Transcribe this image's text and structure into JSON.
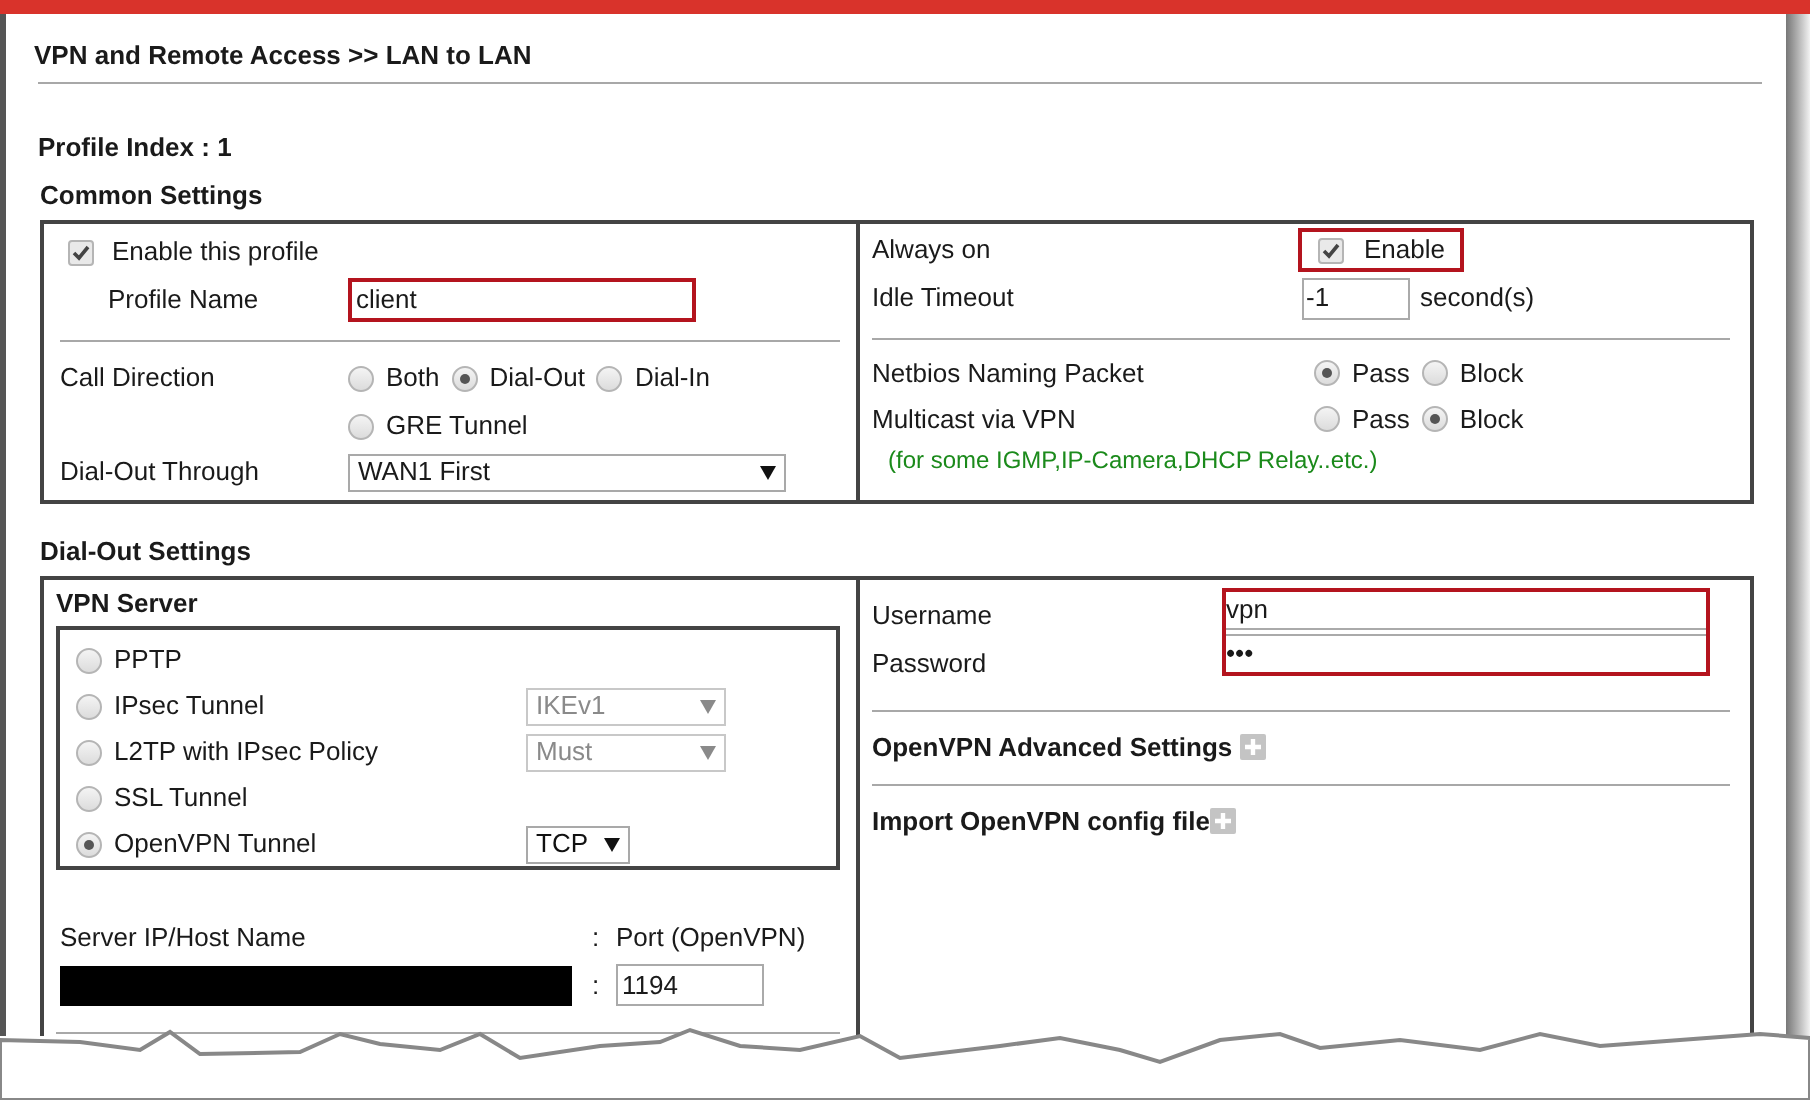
{
  "breadcrumb": "VPN and Remote Access >> LAN to LAN",
  "profile_index": "Profile Index : 1",
  "common_settings": {
    "title": "Common Settings",
    "enable_profile": {
      "label": "Enable this profile",
      "checked": true
    },
    "profile_name": {
      "label": "Profile Name",
      "value": "client",
      "highlighted": true
    },
    "call_direction": {
      "label": "Call Direction",
      "options": [
        {
          "label": "Both",
          "selected": false
        },
        {
          "label": "Dial-Out",
          "selected": true
        },
        {
          "label": "Dial-In",
          "selected": false
        },
        {
          "label": "GRE Tunnel",
          "selected": false
        }
      ]
    },
    "dial_out_through": {
      "label": "Dial-Out Through",
      "value": "WAN1 First"
    },
    "always_on": {
      "label": "Always on",
      "option": "Enable",
      "checked": true,
      "highlighted": true
    },
    "idle_timeout": {
      "label": "Idle Timeout",
      "value": "-1",
      "unit": "second(s)"
    },
    "netbios": {
      "label": "Netbios Naming Packet",
      "options": [
        {
          "label": "Pass",
          "selected": true
        },
        {
          "label": "Block",
          "selected": false
        }
      ]
    },
    "multicast": {
      "label": "Multicast via VPN",
      "options": [
        {
          "label": "Pass",
          "selected": false
        },
        {
          "label": "Block",
          "selected": true
        }
      ],
      "note": "(for some IGMP,IP-Camera,DHCP Relay..etc.)"
    }
  },
  "dial_out_settings": {
    "title": "Dial-Out Settings",
    "vpn_server": {
      "title": "VPN Server",
      "options": [
        {
          "label": "PPTP",
          "selected": false
        },
        {
          "label": "IPsec Tunnel",
          "selected": false,
          "select": {
            "value": "IKEv1",
            "disabled": true
          }
        },
        {
          "label": "L2TP with IPsec Policy",
          "selected": false,
          "select": {
            "value": "Must",
            "disabled": true
          }
        },
        {
          "label": "SSL Tunnel",
          "selected": false
        },
        {
          "label": "OpenVPN Tunnel",
          "selected": true,
          "select": {
            "value": "TCP",
            "disabled": false
          }
        }
      ]
    },
    "server_host": {
      "label": "Server IP/Host Name",
      "redacted": true
    },
    "port": {
      "label_separator": ":",
      "label": "Port (OpenVPN)",
      "value_separator": ":",
      "value": "1194"
    },
    "credentials": {
      "highlighted": true,
      "username": {
        "label": "Username",
        "value": "vpn"
      },
      "password": {
        "label": "Password",
        "value": "•••"
      }
    },
    "openvpn_advanced": "OpenVPN Advanced Settings",
    "import_config": "Import OpenVPN config file"
  }
}
